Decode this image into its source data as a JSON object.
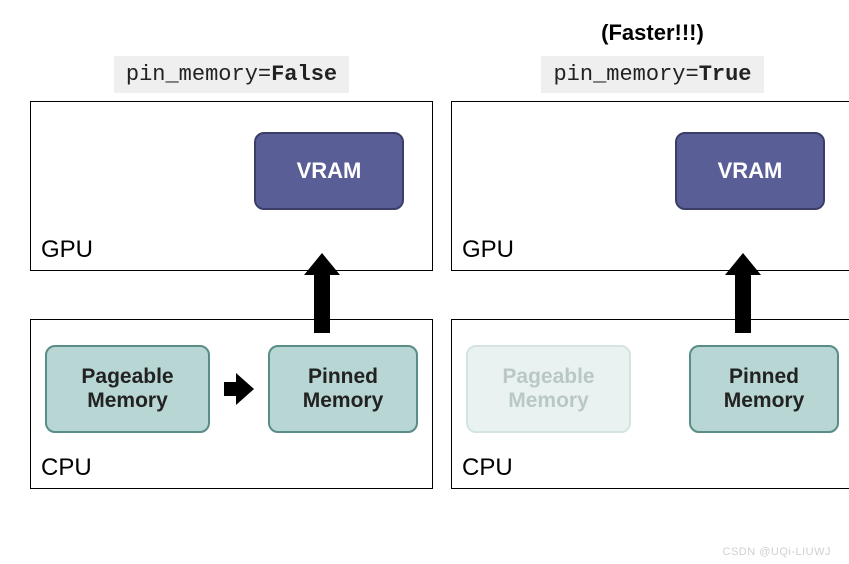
{
  "annotation": {
    "faster": "(Faster!!!)"
  },
  "left": {
    "title_param": "pin_memory=",
    "title_value": "False",
    "gpu": {
      "label": "GPU",
      "vram": "VRAM"
    },
    "cpu": {
      "label": "CPU",
      "pageable": "Pageable\nMemory",
      "pinned": "Pinned\nMemory"
    }
  },
  "right": {
    "title_param": "pin_memory=",
    "title_value": "True",
    "gpu": {
      "label": "GPU",
      "vram": "VRAM"
    },
    "cpu": {
      "label": "CPU",
      "pageable": "Pageable\nMemory",
      "pinned": "Pinned\nMemory"
    }
  },
  "watermark": "CSDN @UQi-LIUWJ"
}
